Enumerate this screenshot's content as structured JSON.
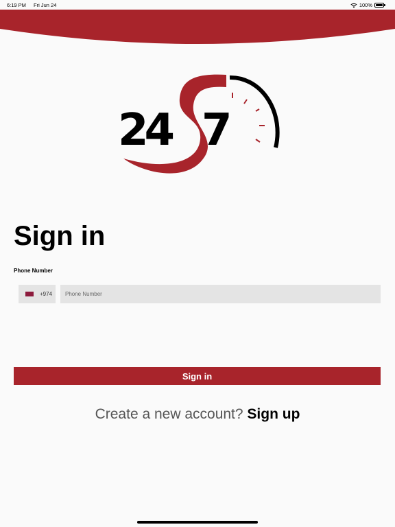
{
  "status_bar": {
    "time": "6:19 PM",
    "date": "Fri Jun 24",
    "battery": "100%",
    "icons": [
      "wifi-icon",
      "battery-icon"
    ]
  },
  "colors": {
    "brand_red": "#a8242b",
    "background": "#fafafa",
    "input_bg": "#e4e4e4"
  },
  "logo": {
    "text_left": "24",
    "text_right": "7"
  },
  "signin": {
    "title": "Sign in",
    "phone_label": "Phone Number",
    "country": {
      "flag": "qatar-flag-icon",
      "dial_code": "+974"
    },
    "phone_placeholder": "Phone Number",
    "phone_value": "",
    "button_label": "Sign in"
  },
  "signup": {
    "prompt": "Create a new account?",
    "link": "Sign up"
  }
}
